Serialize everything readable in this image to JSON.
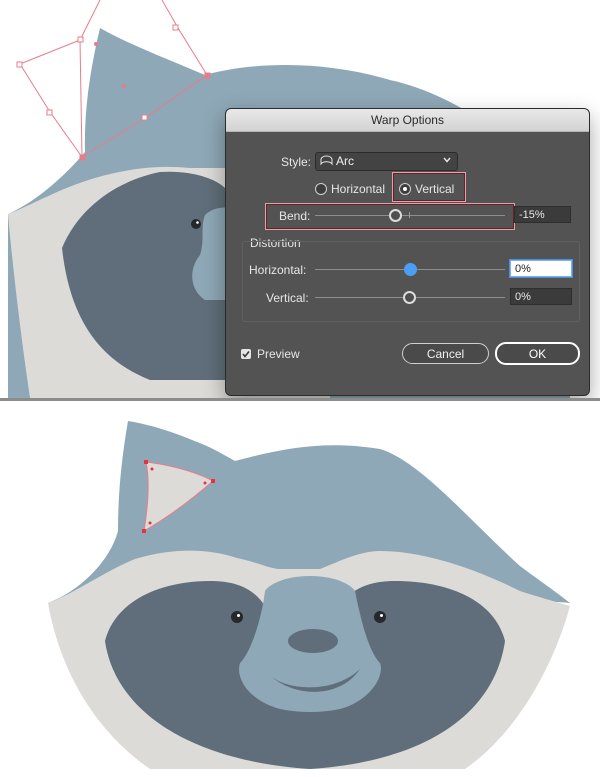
{
  "dialog": {
    "title": "Warp Options",
    "style_label": "Style:",
    "style_value": "Arc",
    "orientation": {
      "horizontal_label": "Horizontal",
      "vertical_label": "Vertical",
      "selected": "Vertical"
    },
    "bend": {
      "label": "Bend:",
      "value": "-15%",
      "position": -0.15
    },
    "distortion": {
      "group_label": "Distortion",
      "horizontal_label": "Horizontal:",
      "horizontal_value": "0%",
      "vertical_label": "Vertical:",
      "vertical_value": "0%"
    },
    "preview_label": "Preview",
    "preview_checked": true,
    "cancel_label": "Cancel",
    "ok_label": "OK"
  },
  "colors": {
    "dialog_bg": "#535353",
    "highlight": "#e0a3ad",
    "raccoon_fur": "#8ea8b7",
    "raccoon_mask": "#5f6e7a",
    "raccoon_cheek": "#dcdbd7",
    "selection": "#e87d8a",
    "active_field": "#4a90e2"
  }
}
